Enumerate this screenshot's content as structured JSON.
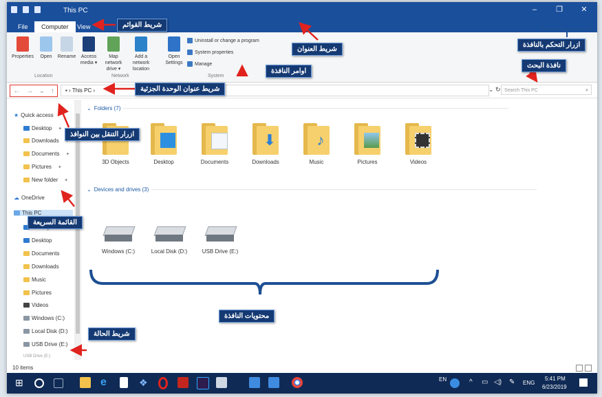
{
  "window": {
    "title": "This PC",
    "buttons": [
      "–",
      "❐",
      "✕"
    ]
  },
  "tabs": [
    {
      "label": "File"
    },
    {
      "label": "Computer"
    },
    {
      "label": "View"
    }
  ],
  "ribbon": {
    "buttons": [
      {
        "label": "Properties",
        "color": "#e34a3a"
      },
      {
        "label": "Open",
        "color": "#9cc6ec"
      },
      {
        "label": "Rename",
        "color": "#c6d6e6"
      },
      {
        "label": "Access media ▾",
        "color": "#1c3f7a"
      },
      {
        "label": "Map network drive ▾",
        "color": "#62a35a"
      },
      {
        "label": "Add a network location",
        "color": "#2c82c9"
      },
      {
        "label": "Open Settings",
        "color": "#2f73c8"
      }
    ],
    "system_items": [
      "Uninstall or change a program",
      "System properties",
      "Manage"
    ],
    "groups": [
      "Location",
      "Network",
      "System"
    ]
  },
  "address": {
    "path": "This PC",
    "search_placeholder": "Search This PC",
    "nav": [
      "←",
      "→",
      "⌄",
      "↑"
    ]
  },
  "navpane": {
    "quick_access": "Quick access",
    "items": [
      "Desktop",
      "Downloads",
      "Documents",
      "Pictures",
      "New folder"
    ],
    "onedrive": "OneDrive",
    "thispc": "This PC",
    "pc_items": [
      "3D Objects",
      "Desktop",
      "Documents",
      "Downloads",
      "Music",
      "Pictures",
      "Videos",
      "Windows (C:)",
      "Local Disk (D:)",
      "USB Drive (E:)",
      "USB Drive (E:)"
    ]
  },
  "content": {
    "folders_header": "Folders (7)",
    "folders": [
      "3D Objects",
      "Desktop",
      "Documents",
      "Downloads",
      "Music",
      "Pictures",
      "Videos"
    ],
    "drives_header": "Devices and drives (3)",
    "drives": [
      "Windows (C:)",
      "Local Disk (D:)",
      "USB Drive (E:)"
    ]
  },
  "status": {
    "text": "10 items"
  },
  "taskbar": {
    "time": "5:41 PM",
    "date": "6/23/2019",
    "lang": "ENG",
    "en": "EN"
  },
  "callouts": {
    "menu_bar": "شريط القوائم",
    "title_bar": "شريط العنوان",
    "window_controls": "ازرار التحكم بالنافذة",
    "search": "نافذة البحث",
    "commands": "اوامر النافذة",
    "subunit_bar": "شريط عنوان الوحدة الجزئية",
    "nav_buttons": "ازرار التنقل بين النوافذ",
    "quick_list": "القائمة السريعة",
    "contents": "محتويات النافذة",
    "status": "شريط الحالة"
  }
}
